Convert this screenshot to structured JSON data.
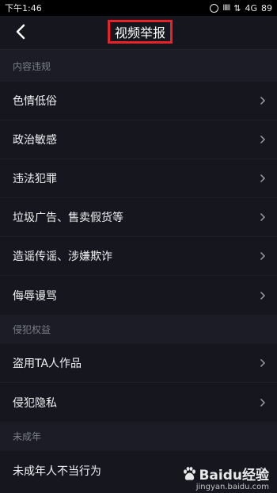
{
  "status_bar": {
    "time": "下午1:46",
    "signal": "lllll",
    "network": "4G",
    "battery": "89"
  },
  "header": {
    "title": "视频举报",
    "back_icon": "chevron-left-icon"
  },
  "sections": [
    {
      "title": "内容违规",
      "items": [
        "色情低俗",
        "政治敏感",
        "违法犯罪",
        "垃圾广告、售卖假货等",
        "造谣传谣、涉嫌欺诈",
        "侮辱谩骂"
      ]
    },
    {
      "title": "侵犯权益",
      "items": [
        "盗用TA人作品",
        "侵犯隐私"
      ]
    },
    {
      "title": "未成年",
      "items": [
        "未成年人不当行为"
      ]
    }
  ],
  "watermark": {
    "brand": "Baidu经验",
    "url": "jingyan.baidu.com"
  },
  "colors": {
    "background": "#15161e",
    "section_bg": "#1b1c25",
    "highlight": "#e8222a",
    "muted_text": "#7c7e88"
  }
}
